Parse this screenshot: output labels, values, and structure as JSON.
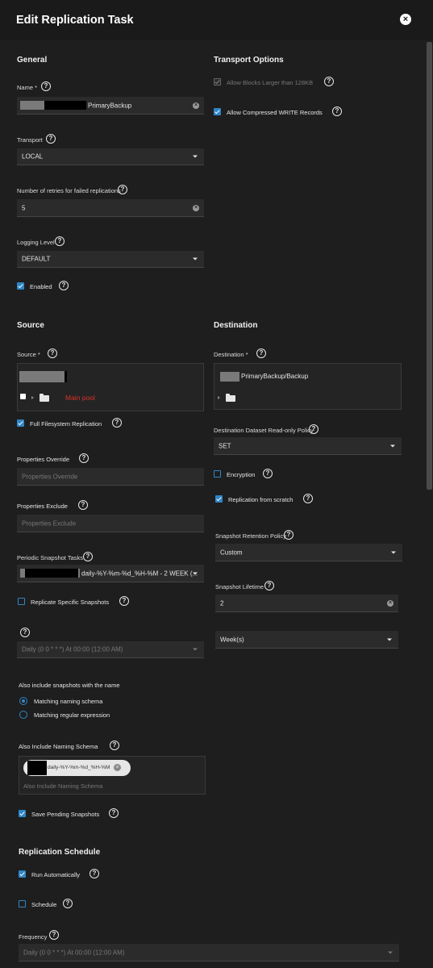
{
  "header": {
    "title": "Edit Replication Task"
  },
  "general": {
    "heading": "General",
    "name_label": "Name *",
    "name_value": "PrimaryBackup",
    "transport_label": "Transport",
    "transport_value": "LOCAL",
    "retries_label": "Number of retries for failed replications",
    "retries_value": "5",
    "logging_label": "Logging Level",
    "logging_value": "DEFAULT",
    "enabled_label": "Enabled"
  },
  "transport_options": {
    "heading": "Transport Options",
    "allow_blocks_label": "Allow Blocks Larger than 128KB",
    "allow_compressed_label": "Allow Compressed WRITE Records"
  },
  "source": {
    "heading": "Source",
    "source_label": "Source *",
    "tree_label": "Main pool",
    "full_fs_label": "Full Filesystem Replication",
    "props_override_label": "Properties Override",
    "props_override_placeholder": "Properties Override",
    "props_exclude_label": "Properties Exclude",
    "props_exclude_placeholder": "Properties Exclude",
    "periodic_label": "Periodic Snapshot Tasks",
    "periodic_value": "daily-%Y-%m-%d_%H-%M - 2 WEEK (...",
    "replicate_specific_label": "Replicate Specific Snapshots",
    "schedule_value": "Daily (0 0 * * *)  At 00:00 (12:00 AM)",
    "also_include_label": "Also include snapshots with the name",
    "radio_naming": "Matching naming schema",
    "radio_regex": "Matching regular expression",
    "naming_schema_label": "Also Include Naming Schema",
    "chip_value": "daily-%Y-%m-%d_%H-%M",
    "naming_schema_placeholder": "Also Include Naming Schema",
    "save_pending_label": "Save Pending Snapshots"
  },
  "destination": {
    "heading": "Destination",
    "dest_label": "Destination *",
    "dest_value": "PrimaryBackup/Backup",
    "readonly_label": "Destination Dataset Read-only Policy",
    "readonly_value": "SET",
    "encryption_label": "Encryption",
    "from_scratch_label": "Replication from scratch",
    "retention_label": "Snapshot Retention Policy",
    "retention_value": "Custom",
    "lifetime_label": "Snapshot Lifetime",
    "lifetime_value": "2",
    "lifetime_unit": "Week(s)"
  },
  "schedule": {
    "heading": "Replication Schedule",
    "run_auto_label": "Run Automatically",
    "schedule_label": "Schedule",
    "frequency_label": "Frequency",
    "frequency_value": "Daily (0 0 * * *)  At 00:00 (12:00 AM)"
  },
  "colors": {
    "accent": "#2f86c6",
    "warning_red": "#d9322b"
  }
}
